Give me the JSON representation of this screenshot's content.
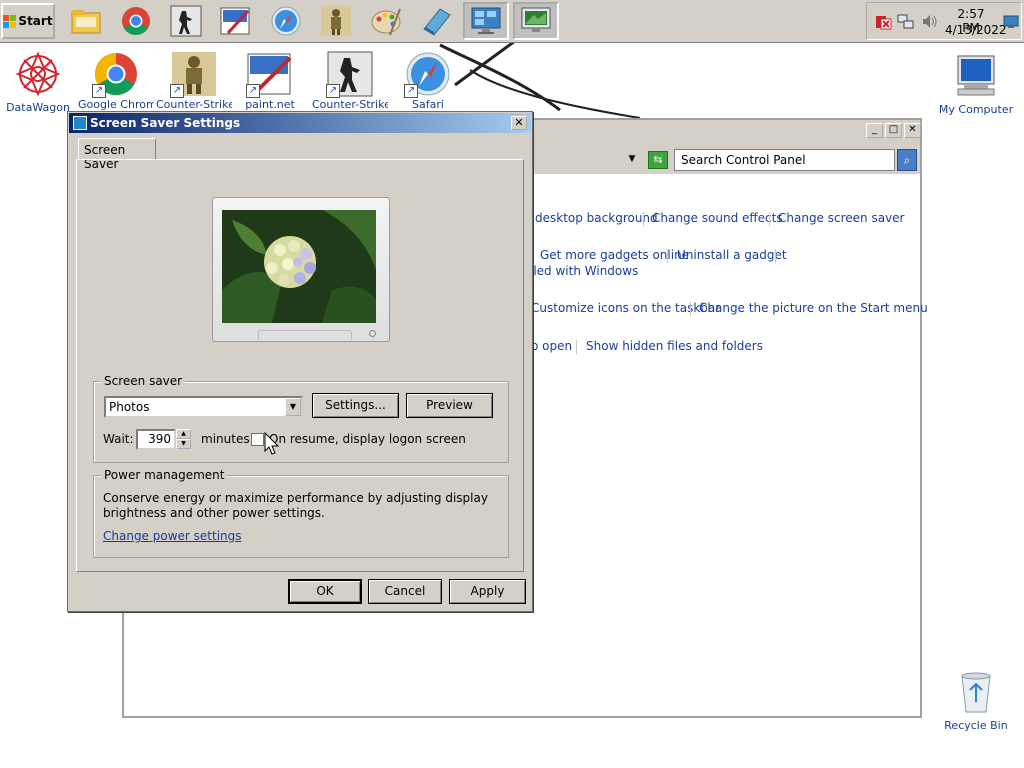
{
  "taskbar": {
    "start_label": "Start",
    "pinned": [
      "file-explorer-icon",
      "chrome-icon",
      "counter-strike-icon",
      "paint-icon",
      "safari-icon",
      "soldier-icon",
      "palette-icon",
      "notebook-icon",
      "control-panel-icon",
      "display-settings-icon"
    ],
    "clock_time": "2:57 PM",
    "clock_date": "4/13/2022"
  },
  "desktop": {
    "icons": [
      {
        "label": "DataWagon",
        "icon": "datawagon-icon"
      },
      {
        "label": "Google Chrome",
        "icon": "chrome-icon"
      },
      {
        "label": "Counter-Strike",
        "icon": "soldier-icon"
      },
      {
        "label": "paint.net",
        "icon": "paint-icon"
      },
      {
        "label": "Counter-Strike",
        "icon": "counter-strike-icon"
      },
      {
        "label": "Safari",
        "icon": "safari-icon"
      }
    ],
    "my_computer": "My Computer",
    "recycle_bin": "Recycle Bin"
  },
  "control_panel": {
    "search_placeholder": "Search Control Panel",
    "links": [
      "desktop background",
      "Change sound effects",
      "Change screen saver",
      "Get more gadgets online",
      "Uninstall a gadget",
      "lled with Windows",
      "Customize icons on the taskbar",
      "Change the picture on the Start menu",
      "o open",
      "Show hidden files and folders"
    ]
  },
  "dialog": {
    "title": "Screen Saver Settings",
    "tab_label": "Screen Saver",
    "screen_saver": {
      "group_label": "Screen saver",
      "selected": "Photos",
      "settings_button": "Settings...",
      "preview_button": "Preview",
      "wait_label": "Wait:",
      "wait_value": "390",
      "minutes_label": "minutes",
      "resume_label": "On resume, display logon screen",
      "resume_checked": false
    },
    "power": {
      "group_label": "Power management",
      "description_line1": "Conserve energy or maximize performance by adjusting display",
      "description_line2": "brightness and other power settings.",
      "link": "Change power settings"
    },
    "buttons": {
      "ok": "OK",
      "cancel": "Cancel",
      "apply": "Apply"
    }
  }
}
